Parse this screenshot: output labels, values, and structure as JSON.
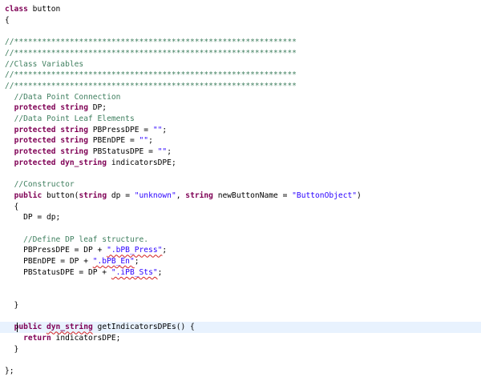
{
  "colors": {
    "keyword": "#7f0055",
    "comment": "#3f7f5f",
    "string": "#2a00ff",
    "plain": "#000000",
    "current_line": "#e8f2fe"
  },
  "editor": {
    "lines": [
      [
        {
          "t": "class",
          "k": "kw"
        },
        {
          "t": " button",
          "k": "plain"
        }
      ],
      [
        {
          "t": "{",
          "k": "plain"
        }
      ],
      [],
      [
        {
          "t": "//*************************************************************",
          "k": "comment"
        }
      ],
      [
        {
          "t": "//*************************************************************",
          "k": "comment"
        }
      ],
      [
        {
          "t": "//Class Variables",
          "k": "comment"
        }
      ],
      [
        {
          "t": "//*************************************************************",
          "k": "comment"
        }
      ],
      [
        {
          "t": "//*************************************************************",
          "k": "comment"
        }
      ],
      [
        {
          "t": "  ",
          "k": "plain"
        },
        {
          "t": "//Data Point Connection",
          "k": "comment"
        }
      ],
      [
        {
          "t": "  ",
          "k": "plain"
        },
        {
          "t": "protected",
          "k": "kw"
        },
        {
          "t": " ",
          "k": "plain"
        },
        {
          "t": "string",
          "k": "kw"
        },
        {
          "t": " DP;",
          "k": "plain"
        }
      ],
      [
        {
          "t": "  ",
          "k": "plain"
        },
        {
          "t": "//Data Point Leaf Elements",
          "k": "comment"
        }
      ],
      [
        {
          "t": "  ",
          "k": "plain"
        },
        {
          "t": "protected",
          "k": "kw"
        },
        {
          "t": " ",
          "k": "plain"
        },
        {
          "t": "string",
          "k": "kw"
        },
        {
          "t": " PBPressDPE = ",
          "k": "plain"
        },
        {
          "t": "\"\"",
          "k": "string"
        },
        {
          "t": ";",
          "k": "plain"
        }
      ],
      [
        {
          "t": "  ",
          "k": "plain"
        },
        {
          "t": "protected",
          "k": "kw"
        },
        {
          "t": " ",
          "k": "plain"
        },
        {
          "t": "string",
          "k": "kw"
        },
        {
          "t": " PBEnDPE = ",
          "k": "plain"
        },
        {
          "t": "\"\"",
          "k": "string"
        },
        {
          "t": ";",
          "k": "plain"
        }
      ],
      [
        {
          "t": "  ",
          "k": "plain"
        },
        {
          "t": "protected",
          "k": "kw"
        },
        {
          "t": " ",
          "k": "plain"
        },
        {
          "t": "string",
          "k": "kw"
        },
        {
          "t": " PBStatusDPE = ",
          "k": "plain"
        },
        {
          "t": "\"\"",
          "k": "string"
        },
        {
          "t": ";",
          "k": "plain"
        }
      ],
      [
        {
          "t": "  ",
          "k": "plain"
        },
        {
          "t": "protected",
          "k": "kw"
        },
        {
          "t": " ",
          "k": "plain"
        },
        {
          "t": "dyn_string",
          "k": "kw"
        },
        {
          "t": " indicatorsDPE;",
          "k": "plain"
        }
      ],
      [],
      [
        {
          "t": "  ",
          "k": "plain"
        },
        {
          "t": "//Constructor",
          "k": "comment"
        }
      ],
      [
        {
          "t": "  ",
          "k": "plain"
        },
        {
          "t": "public",
          "k": "kw"
        },
        {
          "t": " button(",
          "k": "plain"
        },
        {
          "t": "string",
          "k": "kw"
        },
        {
          "t": " dp = ",
          "k": "plain"
        },
        {
          "t": "\"unknown\"",
          "k": "string"
        },
        {
          "t": ", ",
          "k": "plain"
        },
        {
          "t": "string",
          "k": "kw"
        },
        {
          "t": " newButtonName = ",
          "k": "plain"
        },
        {
          "t": "\"ButtonObject\"",
          "k": "string"
        },
        {
          "t": ")",
          "k": "plain"
        }
      ],
      [
        {
          "t": "  {",
          "k": "plain"
        }
      ],
      [
        {
          "t": "    DP = dp;",
          "k": "plain"
        }
      ],
      [],
      [
        {
          "t": "    ",
          "k": "plain"
        },
        {
          "t": "//Define DP leaf structure.",
          "k": "comment"
        }
      ],
      [
        {
          "t": "    PBPressDPE = DP + ",
          "k": "plain"
        },
        {
          "t": "\".bPB_Press\"",
          "k": "string",
          "sq": true
        },
        {
          "t": ";",
          "k": "plain"
        }
      ],
      [
        {
          "t": "    PBEnDPE = DP + ",
          "k": "plain"
        },
        {
          "t": "\".bPB_En\"",
          "k": "string",
          "sq": true
        },
        {
          "t": ";",
          "k": "plain"
        }
      ],
      [
        {
          "t": "    PBStatusDPE = DP + ",
          "k": "plain"
        },
        {
          "t": "\".iPB_Sts\"",
          "k": "string",
          "sq": true
        },
        {
          "t": ";",
          "k": "plain"
        }
      ],
      [],
      [],
      [
        {
          "t": "  }",
          "k": "plain"
        }
      ],
      [],
      [
        {
          "t": "  ",
          "k": "plain"
        },
        {
          "t": "public",
          "k": "kw"
        },
        {
          "t": " ",
          "k": "plain"
        },
        {
          "t": "dyn_string",
          "k": "kw",
          "sq": true
        },
        {
          "t": " getIndicatorsDPEs() {",
          "k": "plain"
        }
      ],
      [
        {
          "t": "    ",
          "k": "plain"
        },
        {
          "t": "return",
          "k": "kw"
        },
        {
          "t": " indicatorsDPE;",
          "k": "plain"
        }
      ],
      [
        {
          "t": "  }",
          "k": "plain"
        }
      ],
      [],
      [
        {
          "t": "};",
          "k": "plain"
        }
      ]
    ],
    "current_line_index": 29
  }
}
